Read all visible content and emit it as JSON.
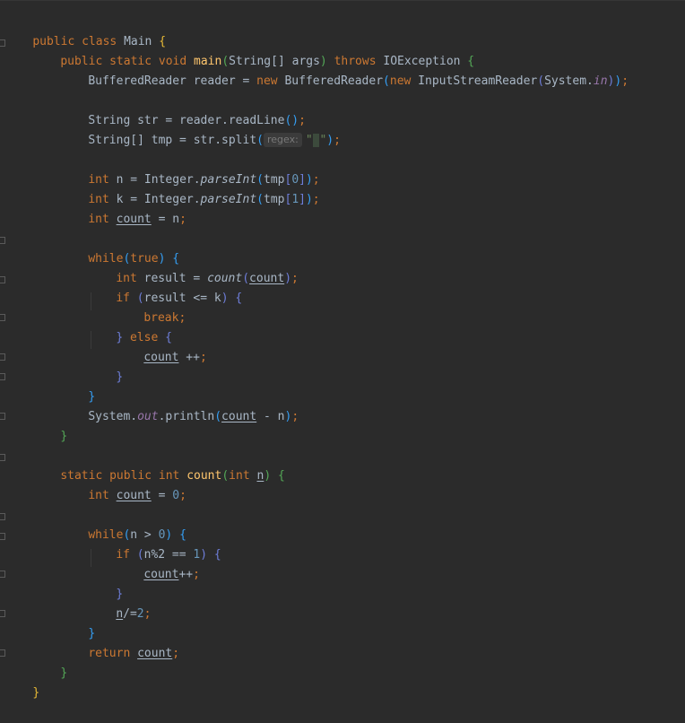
{
  "editor": {
    "language": "java",
    "class_decl": {
      "kw": "public class",
      "name": "Main",
      "brace": "{"
    },
    "main_sig": {
      "mods": "public static void",
      "name": "main",
      "params_open": "(",
      "param_type": "String[] args",
      "params_close": ")",
      "throws_kw": "throws",
      "exception": "IOException",
      "brace": "{"
    },
    "line_reader": {
      "left": "BufferedReader reader = ",
      "new1": "new",
      "ctor1": " BufferedReader",
      "p1": "(",
      "new2": "new",
      "ctor2": " InputStreamReader",
      "p2": "(",
      "sys": "System.",
      "field_in": "in",
      "p2c": ")",
      "p1c": ")",
      "semi": ";"
    },
    "line_str": {
      "text": "String str = reader.readLine",
      "p": "()",
      "semi": ";"
    },
    "line_tmp": {
      "text": "String[] tmp = str.split",
      "p": "(",
      "hint": "regex:",
      "q1": "\"",
      "sp": " ",
      "q2": "\"",
      "pc": ")",
      "semi": ";"
    },
    "line_n": {
      "kw": "int",
      "left": " n = Integer.",
      "fn": "parseInt",
      "p": "(",
      "arg": "tmp",
      "b1": "[",
      "idx": "0",
      "b2": "]",
      "pc": ")",
      "semi": ";"
    },
    "line_k": {
      "kw": "int",
      "left": " k = Integer.",
      "fn": "parseInt",
      "p": "(",
      "arg": "tmp",
      "b1": "[",
      "idx": "1",
      "b2": "]",
      "pc": ")",
      "semi": ";"
    },
    "line_count": {
      "kw": "int",
      "sp": " ",
      "var": "count",
      "rest": " = n",
      "semi": ";"
    },
    "line_while": {
      "kw": "while",
      "p": "(",
      "cond": "true",
      "pc": ")",
      "brace": " {"
    },
    "line_result": {
      "kw": "int",
      "left": " result = ",
      "fn": "count",
      "p": "(",
      "arg": "count",
      "pc": ")",
      "semi": ";"
    },
    "line_if": {
      "kw": "if",
      "p": " (",
      "cond": "result <= k",
      "pc": ")",
      "brace": " {"
    },
    "line_break": {
      "kw": "break",
      "semi": ";"
    },
    "line_else": {
      "brace_close": "}",
      "kw": " else",
      "brace": " {"
    },
    "line_countpp": {
      "var": "count",
      "rest": " ++",
      "semi": ";"
    },
    "line_close_else": {
      "brace": "}"
    },
    "line_close_while": {
      "brace": "}"
    },
    "line_println": {
      "left": "System.",
      "field": "out",
      "mid": ".println",
      "p": "(",
      "var": "count",
      "rest": " - n",
      "pc": ")",
      "semi": ";"
    },
    "line_close_main": {
      "brace": "}"
    },
    "count_sig": {
      "mods": "static public int",
      "name": "count",
      "p": "(",
      "kw": "int",
      "sp": " ",
      "param": "n",
      "pc": ")",
      "brace": " {"
    },
    "line_count2": {
      "kw": "int",
      "sp": " ",
      "var": "count",
      "rest": " = ",
      "num": "0",
      "semi": ";"
    },
    "line_while2": {
      "kw": "while",
      "p": "(",
      "cond": "n > ",
      "num": "0",
      "pc": ")",
      "brace": " {"
    },
    "line_if2": {
      "kw": "if",
      "p": " (",
      "cond": "n%2 == ",
      "num": "1",
      "pc": ")",
      "brace": " {"
    },
    "line_countpp2": {
      "var": "count",
      "rest": "++",
      "semi": ";"
    },
    "line_close_if2": {
      "brace": "}"
    },
    "line_ndiv": {
      "var": "n",
      "rest": "/=",
      "num": "2",
      "semi": ";"
    },
    "line_close_while2": {
      "brace": "}"
    },
    "line_return": {
      "kw": "return",
      "sp": " ",
      "var": "count",
      "semi": ";"
    },
    "line_close_count": {
      "brace": "}"
    },
    "line_close_class": {
      "brace": "}"
    }
  },
  "colors": {
    "background": "#2b2b2b",
    "keyword": "#cc7832",
    "method": "#ffc66d",
    "static_field": "#9876aa",
    "number": "#6897bb",
    "paren_level_1": "#e8ba36",
    "paren_level_2": "#54a857",
    "paren_level_3": "#359ff4",
    "paren_level_4": "#6e7ed9",
    "text": "#a9b7c6"
  }
}
